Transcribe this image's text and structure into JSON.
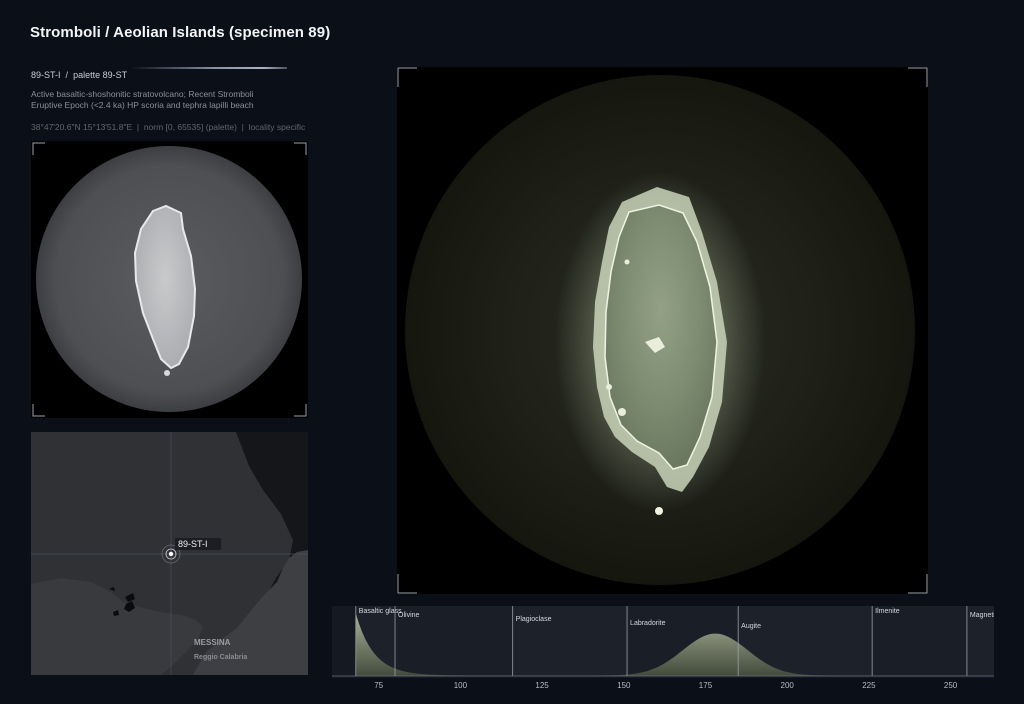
{
  "header": {
    "title": "Stromboli / Aeolian Islands (specimen 89)"
  },
  "specimen": {
    "code": "89-ST-I",
    "separator": "/",
    "palette": "palette 89-ST",
    "description": "Active basaltic-shoshonitic stratovolcano; Recent Stromboli Eruptive Epoch (<2.4 ka) HP scoria and tephra lapilli beach",
    "coords": "38°47'20.6\"N 15°13'51.8\"E",
    "norm": "norm [0, 65535] (palette)",
    "locality": "locality specific"
  },
  "map": {
    "marker_label": "89-ST-I",
    "city_label": "MESSINA",
    "town_label": "Reggio Calabria"
  },
  "histogram": {
    "ticks": [
      "75",
      "100",
      "125",
      "150",
      "175",
      "200",
      "225",
      "250"
    ],
    "minerals": [
      {
        "name": "Basaltic glass",
        "value": 68
      },
      {
        "name": "Olivine",
        "value": 80
      },
      {
        "name": "Plagioclase",
        "value": 116
      },
      {
        "name": "Labradorite",
        "value": 151
      },
      {
        "name": "Augite",
        "value": 185
      },
      {
        "name": "Ilmenite",
        "value": 226
      },
      {
        "name": "Magnetite",
        "value": 255
      }
    ],
    "x_range": [
      65,
      259
    ]
  },
  "colors": {
    "accent": "#d7e6c2",
    "background": "#0b0f18",
    "grain_tint": "#8b9a7e"
  }
}
